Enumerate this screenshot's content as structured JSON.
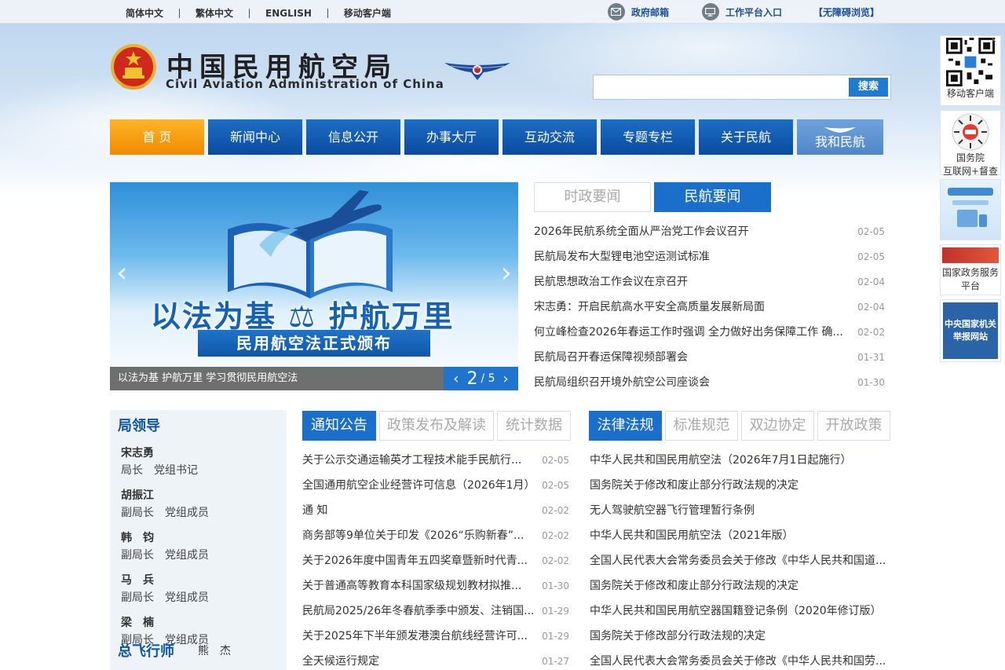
{
  "topbar": {
    "languages": [
      "简体中文",
      "繁体中文",
      "ENGLISH",
      "移动客户端"
    ],
    "gov_mail": "政府邮箱",
    "work_platform": "工作平台入口",
    "accessibility": "【无障碍浏览】"
  },
  "header": {
    "title_cn": "中国民用航空局",
    "title_en": "Civil Aviation Administration of China",
    "search_button": "搜索",
    "search_placeholder": ""
  },
  "nav": {
    "items": [
      "首 页",
      "新闻中心",
      "信息公开",
      "办事大厅",
      "互动交流",
      "专题专栏",
      "关于民航",
      "我和民航"
    ]
  },
  "side": {
    "mobile_client": "移动客户端",
    "gov_supervision_1": "国务院",
    "gov_supervision_2": "互联网+督查",
    "gov_service_1": "国家政务服务",
    "gov_service_2": "平台",
    "report_1": "中央国家机关",
    "report_2": "举报网站",
    "close": "×"
  },
  "carousel": {
    "slide_title": "以法为基 ⚖ 护航万里",
    "slide_subtitle": "民用航空法正式颁布",
    "caption": "以法为基 护航万里 学习贯彻民用航空法",
    "current": "2",
    "total": "/ 5"
  },
  "news": {
    "tabs": [
      "时政要闻",
      "民航要闻"
    ],
    "items": [
      {
        "title": "2026年民航系统全面从严治党工作会议召开",
        "date": "02-05"
      },
      {
        "title": "民航局发布大型锂电池空运测试标准",
        "date": "02-05"
      },
      {
        "title": "民航思想政治工作会议在京召开",
        "date": "02-04"
      },
      {
        "title": "宋志勇：开启民航高水平安全高质量发展新局面",
        "date": "02-04"
      },
      {
        "title": "何立峰检查2026年春运工作时强调 全力做好出务保障工作 确...",
        "date": "02-02"
      },
      {
        "title": "民航局召开春运保障视频部署会",
        "date": "01-31"
      },
      {
        "title": "民航局组织召开境外航空公司座谈会",
        "date": "01-30"
      }
    ]
  },
  "leaders": {
    "heading": "局领导",
    "people": [
      {
        "name": "宋志勇",
        "title": "局长　党组书记"
      },
      {
        "name": "胡振江",
        "title": "副局长　党组成员"
      },
      {
        "name": "韩　钧",
        "title": "副局长　党组成员"
      },
      {
        "name": "马　兵",
        "title": "副局长　党组成员"
      },
      {
        "name": "梁　楠",
        "title": "副局长　党组成员"
      }
    ],
    "pilot_label": "总飞行师",
    "pilot_name": "熊　杰"
  },
  "notices": {
    "tabs": [
      "通知公告",
      "政策发布及解读",
      "统计数据"
    ],
    "items": [
      {
        "title": "关于公示交通运输英才工程技术能手民航行...",
        "date": "02-05"
      },
      {
        "title": "全国通用航空企业经营许可信息（2026年1月）",
        "date": "02-05"
      },
      {
        "title": "通 知",
        "date": "02-02"
      },
      {
        "title": "商务部等9单位关于印发《2026“乐购新春”...",
        "date": "02-02"
      },
      {
        "title": "关于2026年度中国青年五四奖章暨新时代青...",
        "date": "02-02"
      },
      {
        "title": "关于普通高等教育本科国家级规划教材拟推...",
        "date": "01-30"
      },
      {
        "title": "民航局2025/26年冬春航季季中颁发、注销国...",
        "date": "01-29"
      },
      {
        "title": "关于2025年下半年颁发港澳台航线经营许可...",
        "date": "01-29"
      },
      {
        "title": "全天候运行规定",
        "date": "01-27"
      }
    ]
  },
  "laws": {
    "tabs": [
      "法律法规",
      "标准规范",
      "双边协定",
      "开放政策"
    ],
    "items": [
      "中华人民共和国民用航空法（2026年7月1日起施行）",
      "国务院关于修改和废止部分行政法规的决定",
      "无人驾驶航空器飞行管理暂行条例",
      "中华人民共和国民用航空法（2021年版）",
      "全国人民代表大会常务委员会关于修改《中华人民共和国道...",
      "国务院关于修改和废止部分行政法规的决定",
      "中华人民共和国民用航空器国籍登记条例（2020年修订版）",
      "国务院关于修改部分行政法规的决定",
      "全国人民代表大会常务委员会关于修改《中华人民共和国劳..."
    ]
  }
}
